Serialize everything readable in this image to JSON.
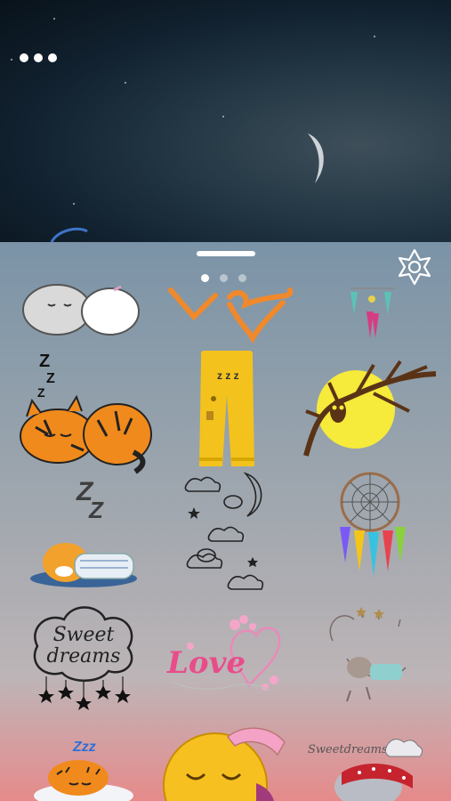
{
  "preview": {
    "more_icon": "more-horizontal-icon",
    "moon_icon": "crescent-moon-icon"
  },
  "sheet": {
    "settings_icon": "flower-gear-icon",
    "page_count": 3,
    "active_page": 1
  },
  "stickers": {
    "sweet_dreams_cloud": {
      "line1": "Sweet",
      "line2": "dreams"
    },
    "love": {
      "text": "Love"
    },
    "zzz": {
      "text": "z z z"
    },
    "garfield_zzz": {
      "text": "Zzz"
    },
    "sweetdreams_bear": {
      "text": "Sweetdreams"
    }
  },
  "colors": {
    "sheet_top": "#7b93a7",
    "sheet_bottom": "#e68a8a",
    "tiger_orange": "#f08a1c",
    "pants_yellow": "#f3c21d",
    "moon_yellow": "#f6ea3a",
    "love_pink": "#e84d8a"
  }
}
